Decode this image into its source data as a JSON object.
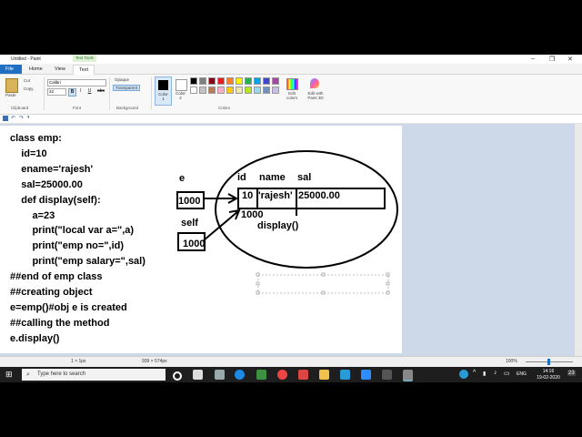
{
  "window": {
    "title": "Untitled - Paint",
    "minimize": "–",
    "maximize": "❐",
    "close": "✕"
  },
  "tabs": {
    "file": "File",
    "home": "Home",
    "view": "View",
    "text": "Text",
    "text_tools": "Text Tools"
  },
  "ribbon": {
    "clipboard": {
      "paste": "Paste",
      "cut": "Cut",
      "copy": "Copy",
      "group": "Clipboard"
    },
    "font": {
      "family": "Calibri",
      "size": "22",
      "group": "Font",
      "bold": "B",
      "italic": "I",
      "underline": "U",
      "strike": "abc"
    },
    "background": {
      "opaque": "Opaque",
      "transparent": "Transparent",
      "group": "Background"
    },
    "colors": {
      "color1": "Color\n1",
      "color2": "Color\n2",
      "group": "Colors",
      "edit_colors": "Edit colors",
      "edit_paint3d": "Edit with Paint 3D",
      "palette": [
        "#000000",
        "#7f7f7f",
        "#880015",
        "#ed1c24",
        "#ff7f27",
        "#fff200",
        "#22b14c",
        "#00a2e8",
        "#3f48cc",
        "#a349a4",
        "#ffffff",
        "#c3c3c3",
        "#b97a57",
        "#ffaec9",
        "#ffc90e",
        "#efe4b0",
        "#b5e61d",
        "#99d9ea",
        "#7092be",
        "#c8bfe7"
      ]
    }
  },
  "code": [
    "class emp:",
    "    id=10",
    "    ename='rajesh'",
    "    sal=25000.00",
    "    def display(self):",
    "        a=23",
    "        print(\"local var a=\",a)",
    "        print(\"emp no=\",id)",
    "        print(\"emp salary=\",sal)",
    "##end of emp class",
    "##creating object",
    "e=emp()#obj e is created",
    "##calling the method",
    "e.display()"
  ],
  "diagram": {
    "e_label": "e",
    "e_value": "1000",
    "self_label": "self",
    "self_value": "1000",
    "col_id": "id",
    "col_name": "name",
    "col_sal": "sal",
    "val_id": "10",
    "val_name": "'rajesh'",
    "val_sal": "25000.00",
    "address": "1000",
    "method": "display()"
  },
  "status": {
    "cursor": "1 × 1px",
    "size": "939 × 574px",
    "zoom": "100%"
  },
  "taskbar": {
    "search_placeholder": "Type here to search",
    "lang": "ENG",
    "time": "14:16",
    "date": "19-02-2020",
    "notifications": "23"
  }
}
